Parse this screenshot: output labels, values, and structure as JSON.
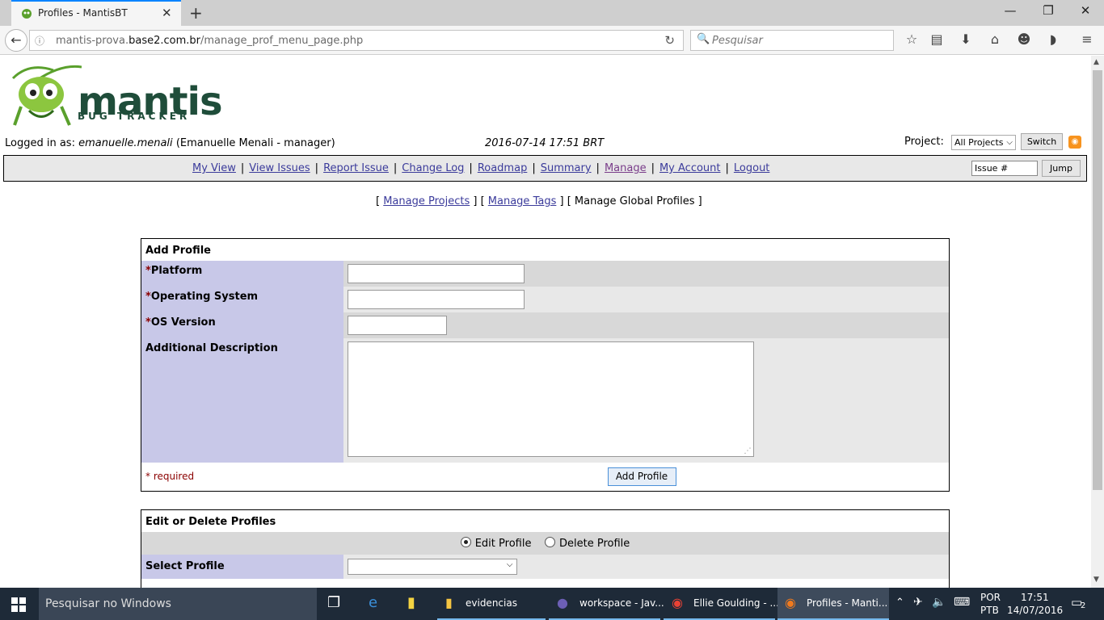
{
  "browser": {
    "tab_title": "Profiles - MantisBT",
    "url_host": "mantis-prova.base2.com.br",
    "url_prefix": "mantis-prova.",
    "url_domain": "base2.com.br",
    "url_path": "/manage_prof_menu_page.php",
    "search_placeholder": "Pesquisar"
  },
  "header": {
    "logo_word": "mantis",
    "logo_sub": "BUG TRACKER",
    "logged_in_label": "Logged in as:",
    "username": "emanuelle.menali",
    "user_detail": "(Emanuelle Menali - manager)",
    "datetime": "2016-07-14 17:51 BRT",
    "project_label": "Project:",
    "project_value": "All Projects",
    "switch_label": "Switch",
    "issue_placeholder": "Issue #",
    "jump_label": "Jump"
  },
  "menu": {
    "items": [
      "My View",
      "View Issues",
      "Report Issue",
      "Change Log",
      "Roadmap",
      "Summary",
      "Manage",
      "My Account",
      "Logout"
    ]
  },
  "submenu": {
    "manage_projects": "Manage Projects",
    "manage_tags": "Manage Tags",
    "current": "Manage Global Profiles"
  },
  "add_profile": {
    "title": "Add Profile",
    "platform": "Platform",
    "os": "Operating System",
    "os_version": "OS Version",
    "description": "Additional Description",
    "required_note": "* required",
    "star": "*",
    "submit": "Add Profile"
  },
  "edit_profile": {
    "title": "Edit or Delete Profiles",
    "edit_option": "Edit Profile",
    "delete_option": "Delete Profile",
    "selected": "edit",
    "select_label": "Select Profile"
  },
  "taskbar": {
    "search_placeholder": "Pesquisar no Windows",
    "apps": [
      "evidencias",
      "workspace - Jav...",
      "Ellie Goulding - ...",
      "Profiles - Manti..."
    ],
    "lang_top": "POR",
    "lang_bottom": "PTB",
    "time": "17:51",
    "date": "14/07/2016",
    "notifications": "2"
  }
}
